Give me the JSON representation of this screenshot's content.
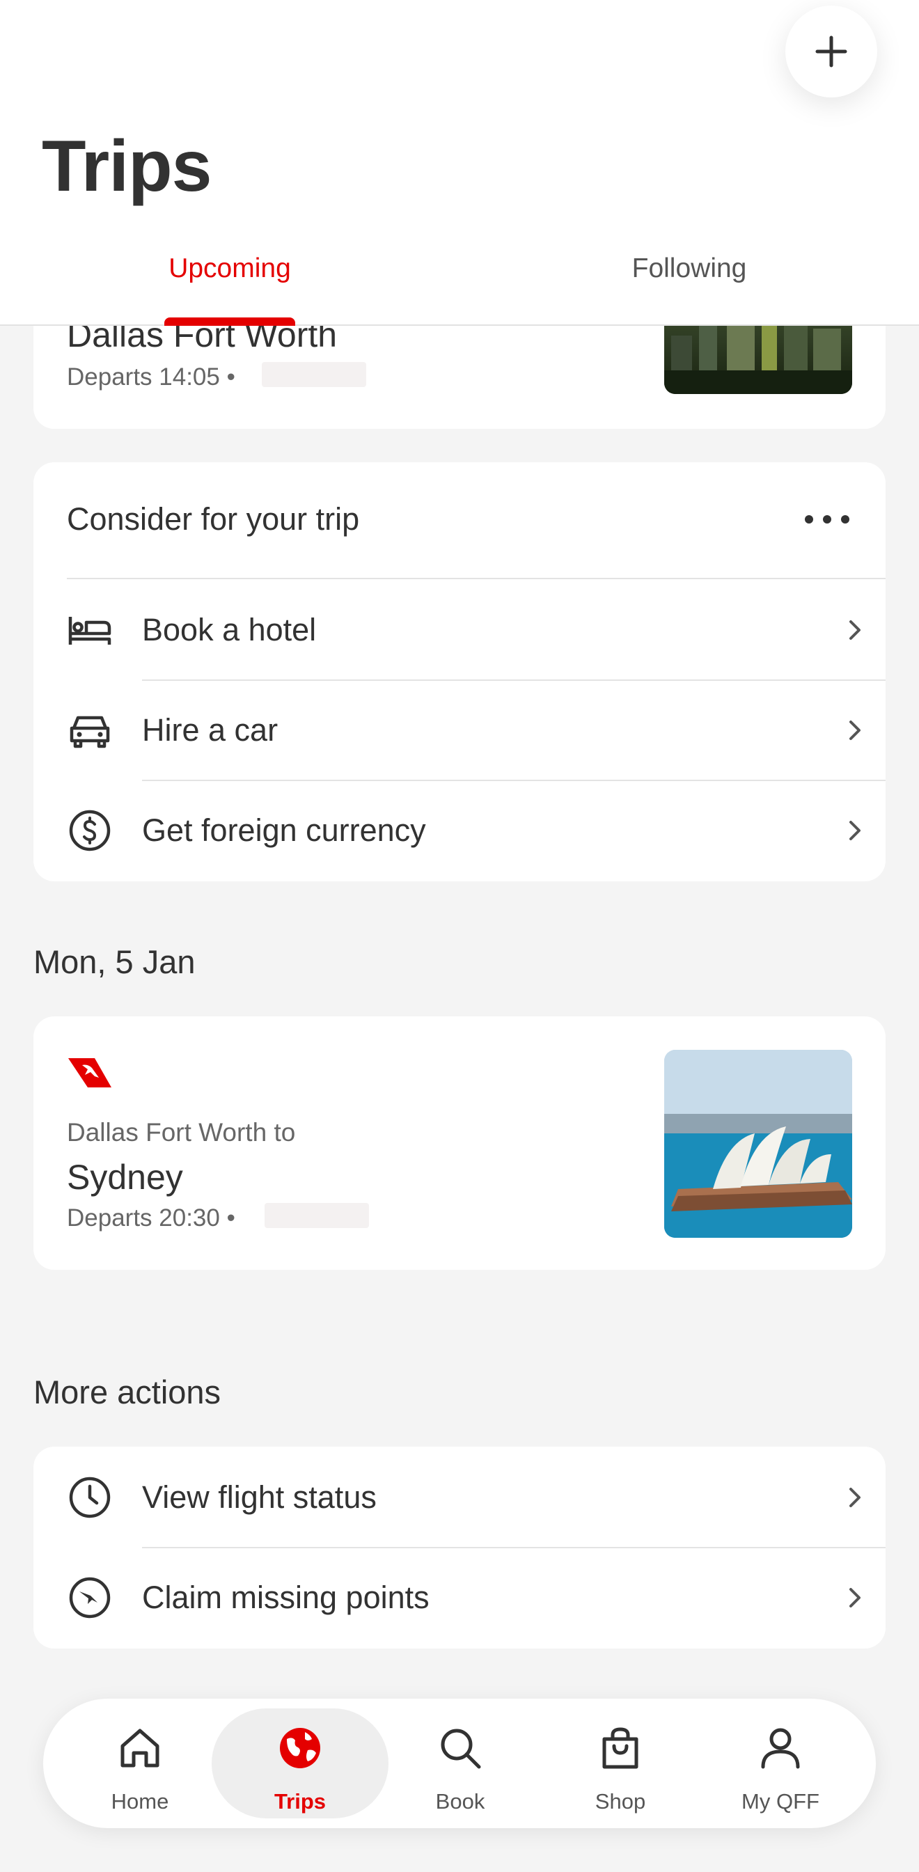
{
  "header": {
    "title": "Trips",
    "add_label": "+",
    "tabs": [
      {
        "label": "Upcoming",
        "active": true
      },
      {
        "label": "Following",
        "active": false
      }
    ]
  },
  "trip_partial": {
    "destination": "Dallas Fort Worth",
    "departs": "Departs 14:05 •"
  },
  "consider": {
    "title": "Consider for your trip",
    "items": [
      {
        "label": "Book a hotel",
        "icon": "bed-icon"
      },
      {
        "label": "Hire a car",
        "icon": "car-icon"
      },
      {
        "label": "Get foreign currency",
        "icon": "currency-icon"
      }
    ]
  },
  "date_heading": "Mon, 5 Jan",
  "trip_next": {
    "from": "Dallas Fort Worth to",
    "destination": "Sydney",
    "departs": "Departs 20:30 •"
  },
  "more_actions": {
    "title": "More actions",
    "items": [
      {
        "label": "View flight status",
        "icon": "clock-icon"
      },
      {
        "label": "Claim missing points",
        "icon": "points-icon"
      }
    ]
  },
  "nav": {
    "items": [
      {
        "label": "Home",
        "icon": "home-icon"
      },
      {
        "label": "Trips",
        "icon": "globe-icon",
        "active": true
      },
      {
        "label": "Book",
        "icon": "search-icon"
      },
      {
        "label": "Shop",
        "icon": "shopping-bag-icon"
      },
      {
        "label": "My QFF",
        "icon": "person-icon"
      }
    ]
  },
  "colors": {
    "accent": "#e40000",
    "text": "#323232",
    "background": "#f4f4f4"
  }
}
